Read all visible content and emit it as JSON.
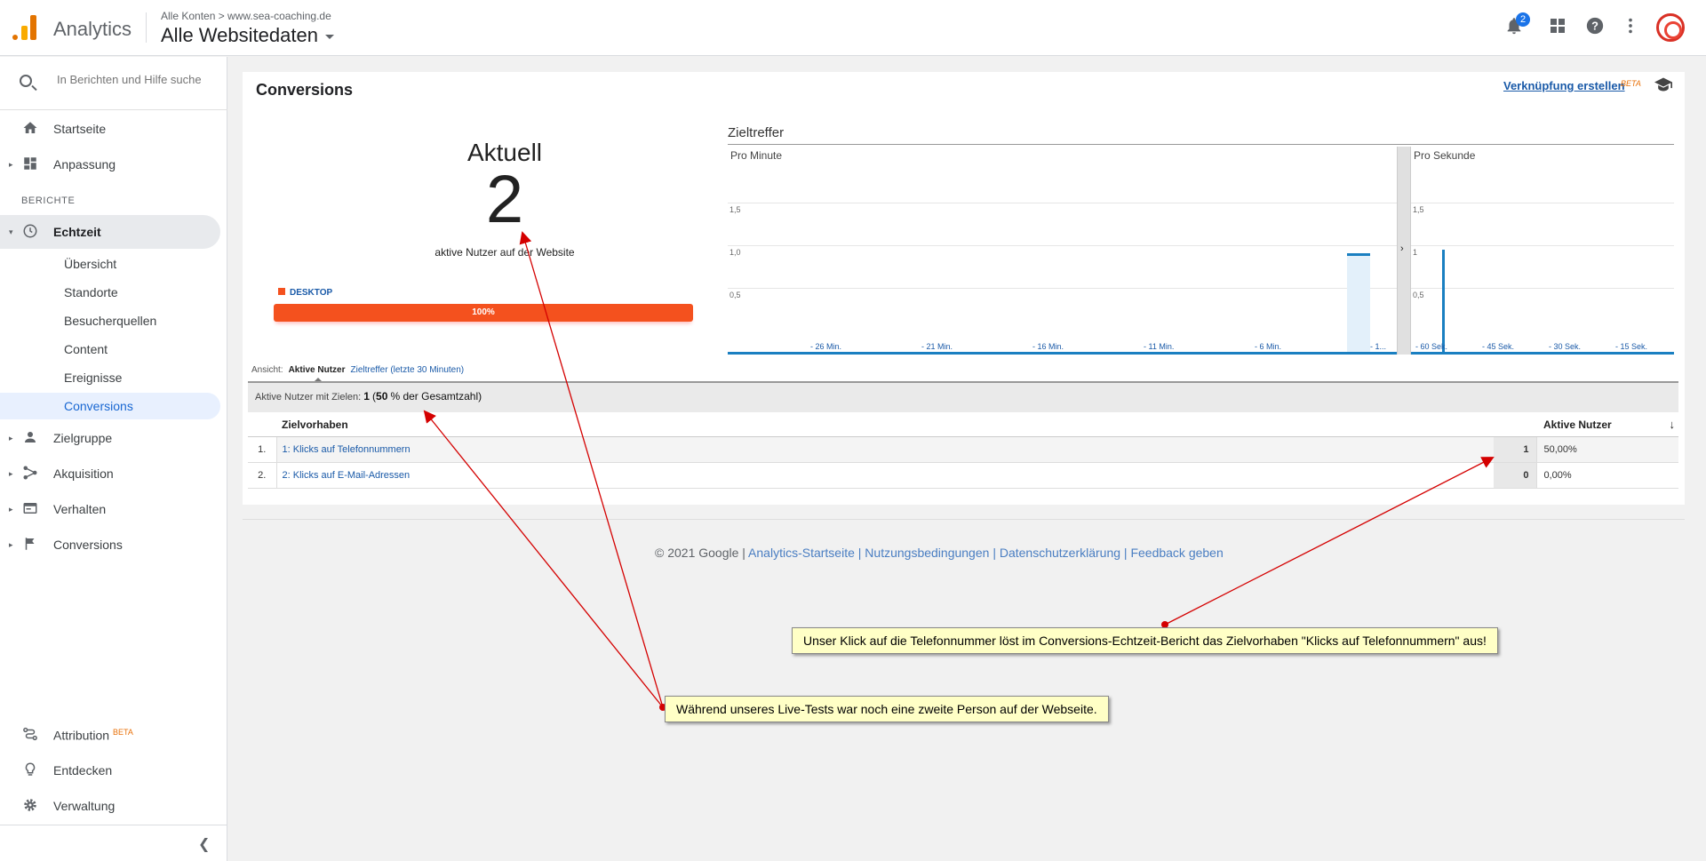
{
  "header": {
    "app_name": "Analytics",
    "breadcrumb": "Alle Konten > www.sea-coaching.de",
    "view_name": "Alle Websitedaten",
    "notification_count": "2",
    "icons": [
      "bell-icon",
      "apps-grid-icon",
      "help-icon",
      "more-vert-icon",
      "avatar"
    ]
  },
  "sidebar": {
    "search_placeholder": "In Berichten und Hilfe suche",
    "items_top": [
      {
        "label": "Startseite",
        "icon": "home-icon"
      },
      {
        "label": "Anpassung",
        "icon": "dashboard-icon"
      }
    ],
    "section_label": "BERICHTE",
    "realtime": {
      "label": "Echtzeit",
      "icon": "clock-icon",
      "sub": [
        "Übersicht",
        "Standorte",
        "Besucherquellen",
        "Content",
        "Ereignisse",
        "Conversions"
      ]
    },
    "items_reports": [
      {
        "label": "Zielgruppe",
        "icon": "person-icon"
      },
      {
        "label": "Akquisition",
        "icon": "acquisition-icon"
      },
      {
        "label": "Verhalten",
        "icon": "behavior-icon"
      },
      {
        "label": "Conversions",
        "icon": "flag-icon"
      }
    ],
    "items_bottom": [
      {
        "label": "Attribution",
        "badge": "BETA",
        "icon": "attribution-icon"
      },
      {
        "label": "Entdecken",
        "icon": "lightbulb-icon"
      },
      {
        "label": "Verwaltung",
        "icon": "gear-icon"
      }
    ]
  },
  "report": {
    "title": "Conversions",
    "create_link": "Verknüpfung erstellen",
    "beta": "BETA",
    "current_label": "Aktuell",
    "active_users": "2",
    "active_users_caption": "aktive Nutzer auf der Website",
    "device_label": "DESKTOP",
    "device_percent": "100%",
    "chart_title": "Zieltreffer",
    "per_minute": "Pro Minute",
    "per_second": "Pro Sekunde",
    "view_label": "Ansicht:",
    "view_active": "Aktive Nutzer",
    "view_other": "Zieltreffer (letzte 30 Minuten)",
    "summary_label": "Aktive Nutzer mit Zielen:",
    "summary_value": "1",
    "summary_rest_open": "(",
    "summary_percent": "50",
    "summary_rest": "% der Gesamtzahl)",
    "col_goal": "Zielvorhaben",
    "col_users": "Aktive Nutzer",
    "rows": [
      {
        "num": "1.",
        "goal": "1: Klicks auf Telefonnummern",
        "users": "1",
        "pct": "50,00%"
      },
      {
        "num": "2.",
        "goal": "2: Klicks auf E-Mail-Adressen",
        "users": "0",
        "pct": "0,00%"
      }
    ]
  },
  "chart_data": [
    {
      "type": "bar",
      "title": "Zieltreffer",
      "subtitle": "Pro Minute",
      "y_ticks": [
        "1,5",
        "1,0",
        "0,5"
      ],
      "x_tick_labels": [
        "- 26 Min.",
        "- 21 Min.",
        "- 16 Min.",
        "- 11 Min.",
        "- 6 Min.",
        "- 1..."
      ],
      "ylim": [
        0,
        2
      ],
      "series": [
        {
          "values_last_minute": 1
        }
      ]
    },
    {
      "type": "bar",
      "subtitle": "Pro Sekunde",
      "y_ticks": [
        "1,5",
        "1",
        "0,5"
      ],
      "x_tick_labels": [
        "- 60 Sek.",
        "- 45 Sek.",
        "- 30 Sek.",
        "- 15 Sek."
      ],
      "ylim": [
        0,
        2
      ],
      "series": [
        {
          "value_at_spike": 1
        }
      ]
    }
  ],
  "footer": {
    "copyright": "© 2021 Google",
    "sep": "|",
    "links": [
      "Analytics-Startseite",
      "Nutzungsbedingungen",
      "Datenschutzerklärung",
      "Feedback geben"
    ]
  },
  "annotations": {
    "note1": "Unser Klick auf die Telefonnummer löst im Conversions-Echtzeit-Bericht das Zielvorhaben \"Klicks auf Telefonnummern\" aus!",
    "note2": "Während unseres Live-Tests war noch eine zweite Person auf der Webseite.",
    "arrow_color": "#d40000"
  }
}
